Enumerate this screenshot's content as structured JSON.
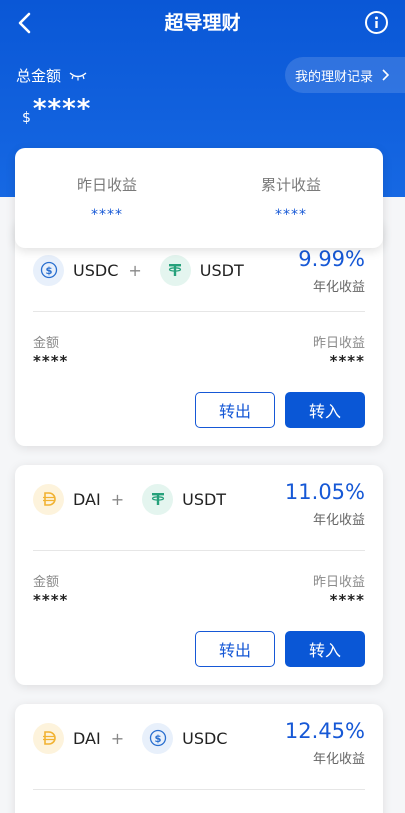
{
  "nav": {
    "title": "超导理财"
  },
  "account": {
    "total_label": "总金额",
    "currency": "$",
    "balance": "****",
    "record_label": "我的理财记录"
  },
  "summary": {
    "yesterday_label": "昨日收益",
    "yesterday_value": "****",
    "cumulative_label": "累计收益",
    "cumulative_value": "****"
  },
  "products": [
    {
      "coin1": "USDC",
      "coin2": "USDT",
      "plus": "+",
      "rate": "9.99%",
      "rate_label": "年化收益",
      "amount_label": "金额",
      "amount": "****",
      "yield_label": "昨日收益",
      "yield": "****",
      "out_label": "转出",
      "in_label": "转入"
    },
    {
      "coin1": "DAI",
      "coin2": "USDT",
      "plus": "+",
      "rate": "11.05%",
      "rate_label": "年化收益",
      "amount_label": "金额",
      "amount": "****",
      "yield_label": "昨日收益",
      "yield": "****",
      "out_label": "转出",
      "in_label": "转入"
    },
    {
      "coin1": "DAI",
      "coin2": "USDC",
      "plus": "+",
      "rate": "12.45%",
      "rate_label": "年化收益"
    }
  ],
  "colors": {
    "brand": "#0a57d6",
    "accent": "#1658d6",
    "usdt": "#26a17b",
    "dai": "#f1b232",
    "usdc": "#2a6fcf"
  }
}
